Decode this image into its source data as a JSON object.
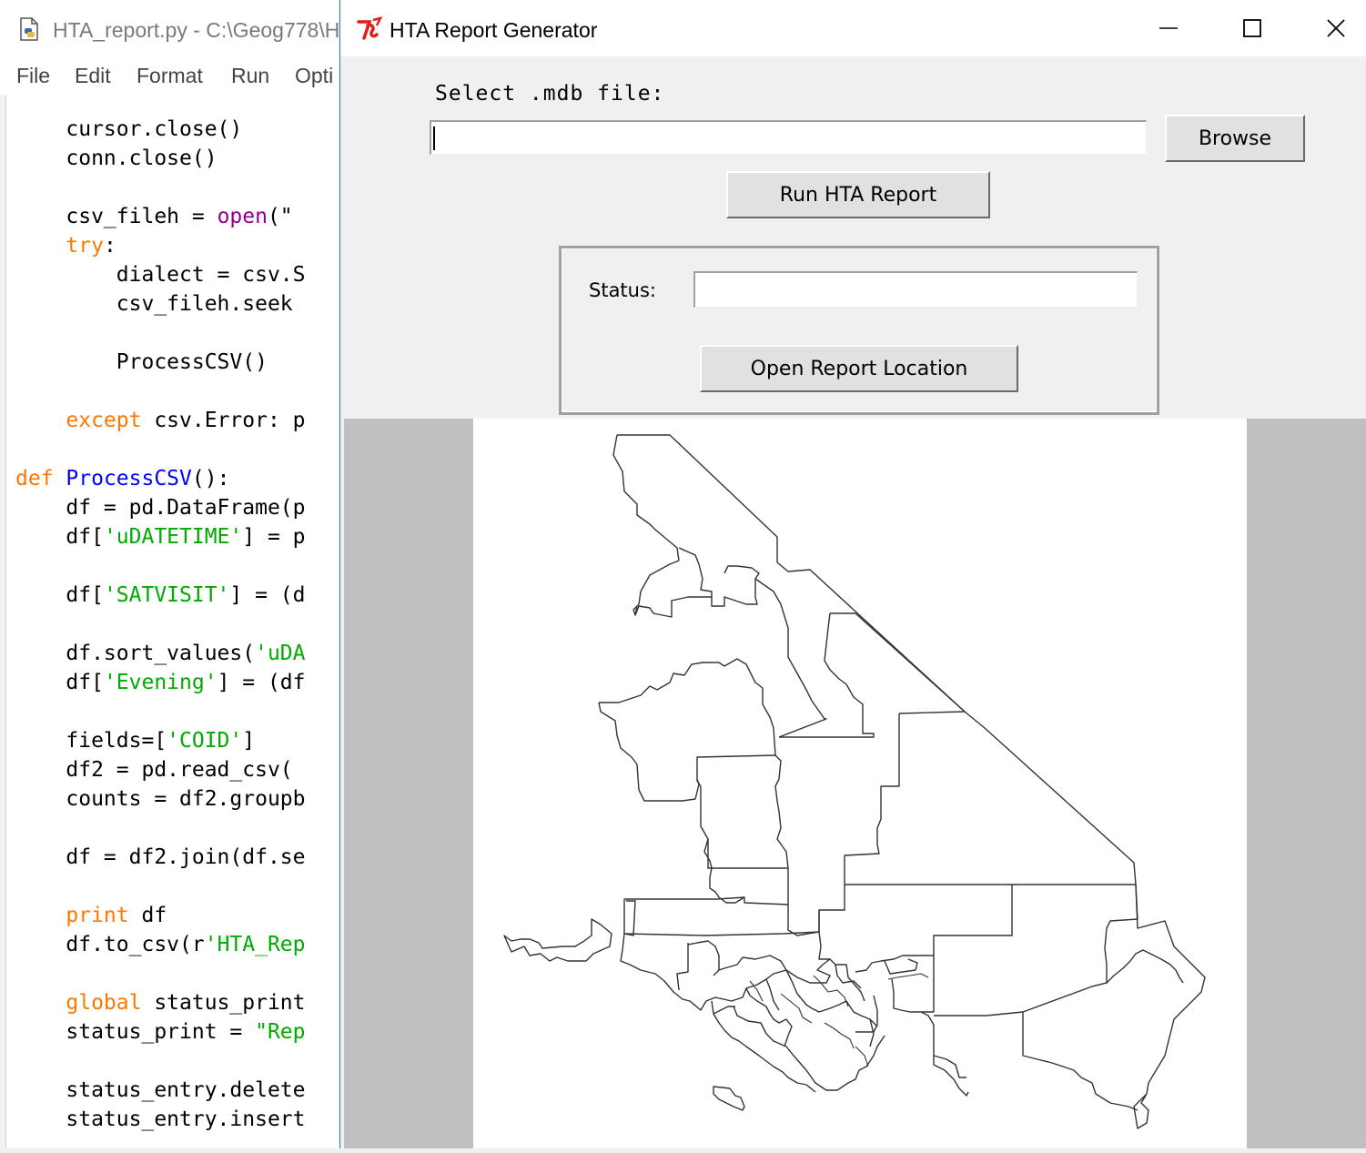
{
  "editor": {
    "title": "HTA_report.py - C:\\Geog778\\H",
    "menu": [
      "File",
      "Edit",
      "Format",
      "Run",
      "Opti"
    ],
    "code_lines": [
      {
        "indent": "    ",
        "parts": [
          [
            "",
            "cursor.close()"
          ]
        ]
      },
      {
        "indent": "    ",
        "parts": [
          [
            "",
            "conn.close()"
          ]
        ]
      },
      {
        "indent": "",
        "parts": []
      },
      {
        "indent": "    ",
        "parts": [
          [
            "",
            "csv_fileh = "
          ],
          [
            "bi",
            "open"
          ],
          [
            "",
            "(\""
          ]
        ]
      },
      {
        "indent": "    ",
        "parts": [
          [
            "kw",
            "try"
          ],
          [
            "",
            ":"
          ]
        ]
      },
      {
        "indent": "        ",
        "parts": [
          [
            "",
            "dialect = csv.S"
          ]
        ]
      },
      {
        "indent": "        ",
        "parts": [
          [
            "",
            "csv_fileh.seek"
          ]
        ]
      },
      {
        "indent": "",
        "parts": []
      },
      {
        "indent": "        ",
        "parts": [
          [
            "",
            "ProcessCSV()"
          ]
        ]
      },
      {
        "indent": "",
        "parts": []
      },
      {
        "indent": "    ",
        "parts": [
          [
            "kw",
            "except"
          ],
          [
            "",
            " csv.Error: p"
          ]
        ]
      },
      {
        "indent": "",
        "parts": []
      },
      {
        "indent": "",
        "parts": [
          [
            "kw",
            "def"
          ],
          [
            "",
            " "
          ],
          [
            "fn",
            "ProcessCSV"
          ],
          [
            "",
            "():"
          ]
        ]
      },
      {
        "indent": "    ",
        "parts": [
          [
            "",
            "df = pd.DataFrame(p"
          ]
        ]
      },
      {
        "indent": "    ",
        "parts": [
          [
            "",
            "df["
          ],
          [
            "st",
            "'uDATETIME'"
          ],
          [
            "",
            "] = p"
          ]
        ]
      },
      {
        "indent": "",
        "parts": []
      },
      {
        "indent": "    ",
        "parts": [
          [
            "",
            "df["
          ],
          [
            "st",
            "'SATVISIT'"
          ],
          [
            "",
            "] = (d"
          ]
        ]
      },
      {
        "indent": "",
        "parts": []
      },
      {
        "indent": "    ",
        "parts": [
          [
            "",
            "df.sort_values("
          ],
          [
            "st",
            "'uDA"
          ]
        ]
      },
      {
        "indent": "    ",
        "parts": [
          [
            "",
            "df["
          ],
          [
            "st",
            "'Evening'"
          ],
          [
            "",
            "] = (df"
          ]
        ]
      },
      {
        "indent": "",
        "parts": []
      },
      {
        "indent": "    ",
        "parts": [
          [
            "",
            "fields=["
          ],
          [
            "st",
            "'COID'"
          ],
          [
            "",
            "]"
          ]
        ]
      },
      {
        "indent": "    ",
        "parts": [
          [
            "",
            "df2 = pd.read_csv("
          ]
        ]
      },
      {
        "indent": "    ",
        "parts": [
          [
            "",
            "counts = df2.groupb"
          ]
        ]
      },
      {
        "indent": "",
        "parts": []
      },
      {
        "indent": "    ",
        "parts": [
          [
            "",
            "df = df2.join(df.se"
          ]
        ]
      },
      {
        "indent": "",
        "parts": []
      },
      {
        "indent": "    ",
        "parts": [
          [
            "kw",
            "print"
          ],
          [
            "",
            " df"
          ]
        ]
      },
      {
        "indent": "    ",
        "parts": [
          [
            "",
            "df.to_csv(r"
          ],
          [
            "st",
            "'HTA_Rep"
          ]
        ]
      },
      {
        "indent": "",
        "parts": []
      },
      {
        "indent": "    ",
        "parts": [
          [
            "kw",
            "global"
          ],
          [
            "",
            " status_print"
          ]
        ]
      },
      {
        "indent": "    ",
        "parts": [
          [
            "",
            "status_print = "
          ],
          [
            "st",
            "\"Rep"
          ]
        ]
      },
      {
        "indent": "",
        "parts": []
      },
      {
        "indent": "    ",
        "parts": [
          [
            "",
            "status_entry.delete"
          ]
        ]
      },
      {
        "indent": "    ",
        "parts": [
          [
            "",
            "status_entry.insert"
          ]
        ]
      }
    ]
  },
  "window": {
    "title": "HTA Report Generator",
    "minimize_icon": "minimize-icon",
    "maximize_icon": "maximize-icon",
    "close_icon": "close-icon"
  },
  "form": {
    "select_label": "Select .mdb file:",
    "mdb_path_value": "",
    "browse_label": "Browse",
    "run_label": "Run HTA Report",
    "status_label": "Status:",
    "status_value": "",
    "open_label": "Open Report Location"
  },
  "map": {
    "description_icon": "county-boundaries-map"
  },
  "colors": {
    "window_bg": "#f0f0f0",
    "map_frame_bg": "#c0c0c0",
    "map_bg": "#ffffff",
    "boundary_line": "#333333",
    "keyword": "#ff7700",
    "builtin": "#900090",
    "string": "#00aa00",
    "function_name": "#0000ff",
    "tk_logo": "#e21b1b"
  }
}
